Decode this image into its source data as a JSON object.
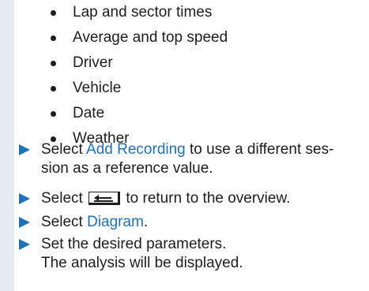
{
  "bullets": [
    "Lap and sector times",
    "Average and top speed",
    "Driver",
    "Vehicle",
    "Date",
    "Weather"
  ],
  "steps": {
    "add_recording": {
      "prefix": "Select ",
      "link": "Add Recording",
      "suffix": " to use a different ses-",
      "line2": "sion as a reference value."
    },
    "return": {
      "prefix": "Select ",
      "icon": "back-key-icon",
      "suffix": " to return to the overview."
    },
    "diagram": {
      "prefix": "Select ",
      "link": "Diagram",
      "suffix": "."
    },
    "parameters": {
      "line1": "Set the desired parameters.",
      "line2": "The analysis will be displayed."
    }
  },
  "colors": {
    "accent": "#1f71b8",
    "sidebar": "#e3ebf4",
    "text": "#1d1d1d"
  }
}
